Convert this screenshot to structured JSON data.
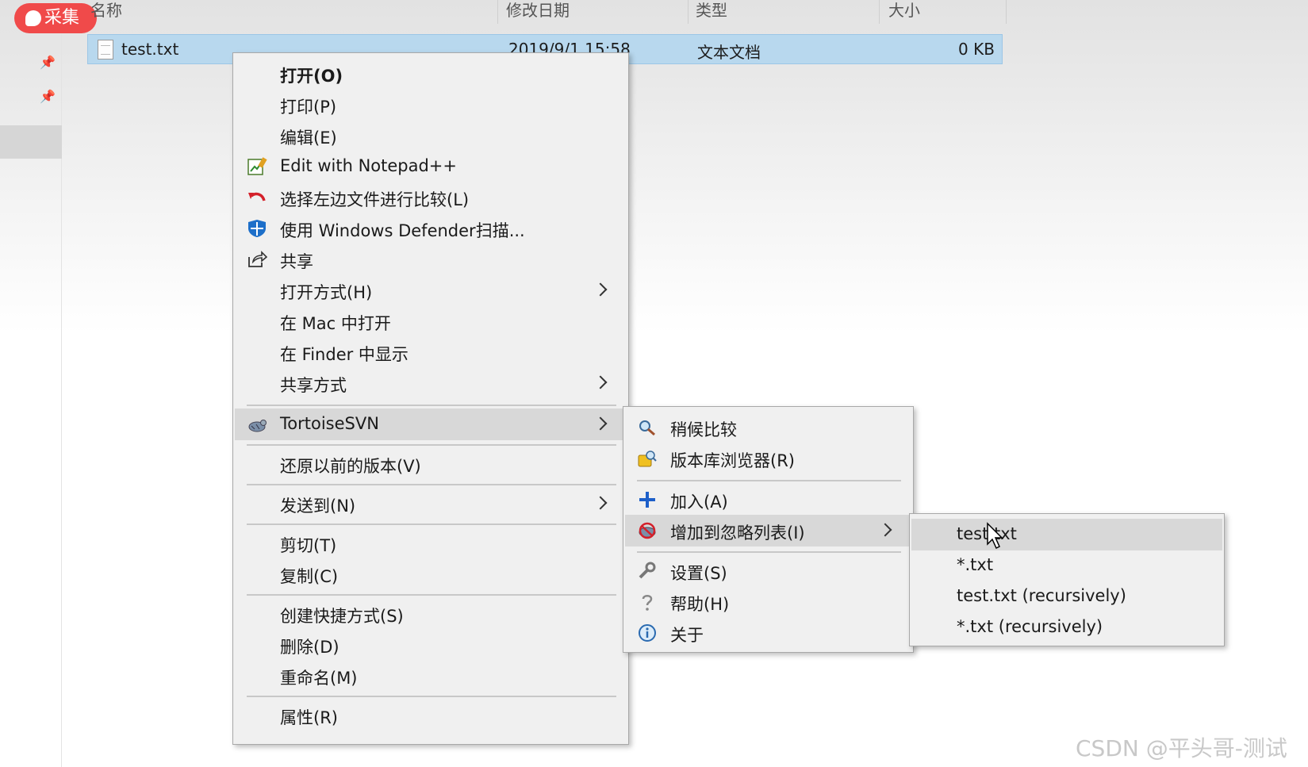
{
  "badge": {
    "label": "采集"
  },
  "columns": {
    "name": "名称",
    "modified": "修改日期",
    "type": "类型",
    "size": "大小"
  },
  "file": {
    "name": "test.txt",
    "modified": "2019/9/1 15:58",
    "type": "文本文档",
    "size": "0 KB"
  },
  "menu_main": {
    "items": [
      {
        "label": "打开(O)"
      },
      {
        "label": "打印(P)"
      },
      {
        "label": "编辑(E)"
      },
      {
        "label": "Edit with Notepad++",
        "icon": "notepad-plus-icon"
      },
      {
        "label": "选择左边文件进行比较(L)",
        "icon": "compare-arrow-icon"
      },
      {
        "label": "使用 Windows Defender扫描...",
        "icon": "windows-defender-icon"
      },
      {
        "label": "共享",
        "icon": "share-icon"
      },
      {
        "label": "打开方式(H)"
      },
      {
        "label": "在 Mac 中打开"
      },
      {
        "label": "在 Finder 中显示"
      },
      {
        "label": "共享方式"
      },
      {
        "label": "TortoiseSVN",
        "icon": "tortoisesvn-icon"
      },
      {
        "label": "还原以前的版本(V)"
      },
      {
        "label": "发送到(N)"
      },
      {
        "label": "剪切(T)"
      },
      {
        "label": "复制(C)"
      },
      {
        "label": "创建快捷方式(S)"
      },
      {
        "label": "删除(D)"
      },
      {
        "label": "重命名(M)"
      },
      {
        "label": "属性(R)"
      }
    ]
  },
  "menu_svn": {
    "items": [
      {
        "label": "稍候比较",
        "icon": "magnifier-icon"
      },
      {
        "label": "版本库浏览器(R)",
        "icon": "repo-browser-icon"
      },
      {
        "label": "加入(A)",
        "icon": "plus-icon"
      },
      {
        "label": "增加到忽略列表(I)",
        "icon": "ignore-icon"
      },
      {
        "label": "设置(S)",
        "icon": "wrench-icon"
      },
      {
        "label": "帮助(H)",
        "icon": "help-icon"
      },
      {
        "label": "关于",
        "icon": "info-icon"
      }
    ]
  },
  "menu_ignore": {
    "items": [
      {
        "label": "test.txt"
      },
      {
        "label": "*.txt"
      },
      {
        "label": "test.txt (recursively)"
      },
      {
        "label": "*.txt (recursively)"
      }
    ]
  },
  "watermark": "CSDN @平头哥-测试",
  "colors": {
    "selection": "#b8d8ee",
    "badge": "#f04a4a",
    "menu_bg": "#f0f0f0",
    "highlight": "#d8d8d8"
  }
}
